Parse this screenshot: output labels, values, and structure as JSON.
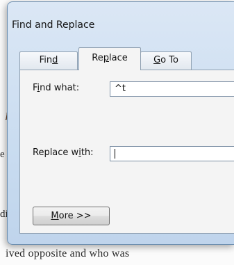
{
  "dialog": {
    "title": "Find and Replace",
    "tabs": {
      "find": {
        "pre": "Fin",
        "u": "d",
        "post": ""
      },
      "replace": {
        "pre": "Re",
        "u": "p",
        "post": "lace"
      },
      "goto": {
        "pre": "",
        "u": "G",
        "post": "o To"
      }
    },
    "find_what": {
      "pre": "F",
      "u": "i",
      "post": "nd what:",
      "value": "^t"
    },
    "replace_with": {
      "pre": "Replace w",
      "u": "i",
      "post": "th:",
      "value": ""
    },
    "more_button": {
      "pre": "",
      "u": "M",
      "post": "ore >>"
    }
  },
  "document": {
    "fragments": {
      "a": "I",
      "b": "e",
      "c": "di",
      "d": "e"
    },
    "bottom_line": "ived opposite and who was"
  }
}
